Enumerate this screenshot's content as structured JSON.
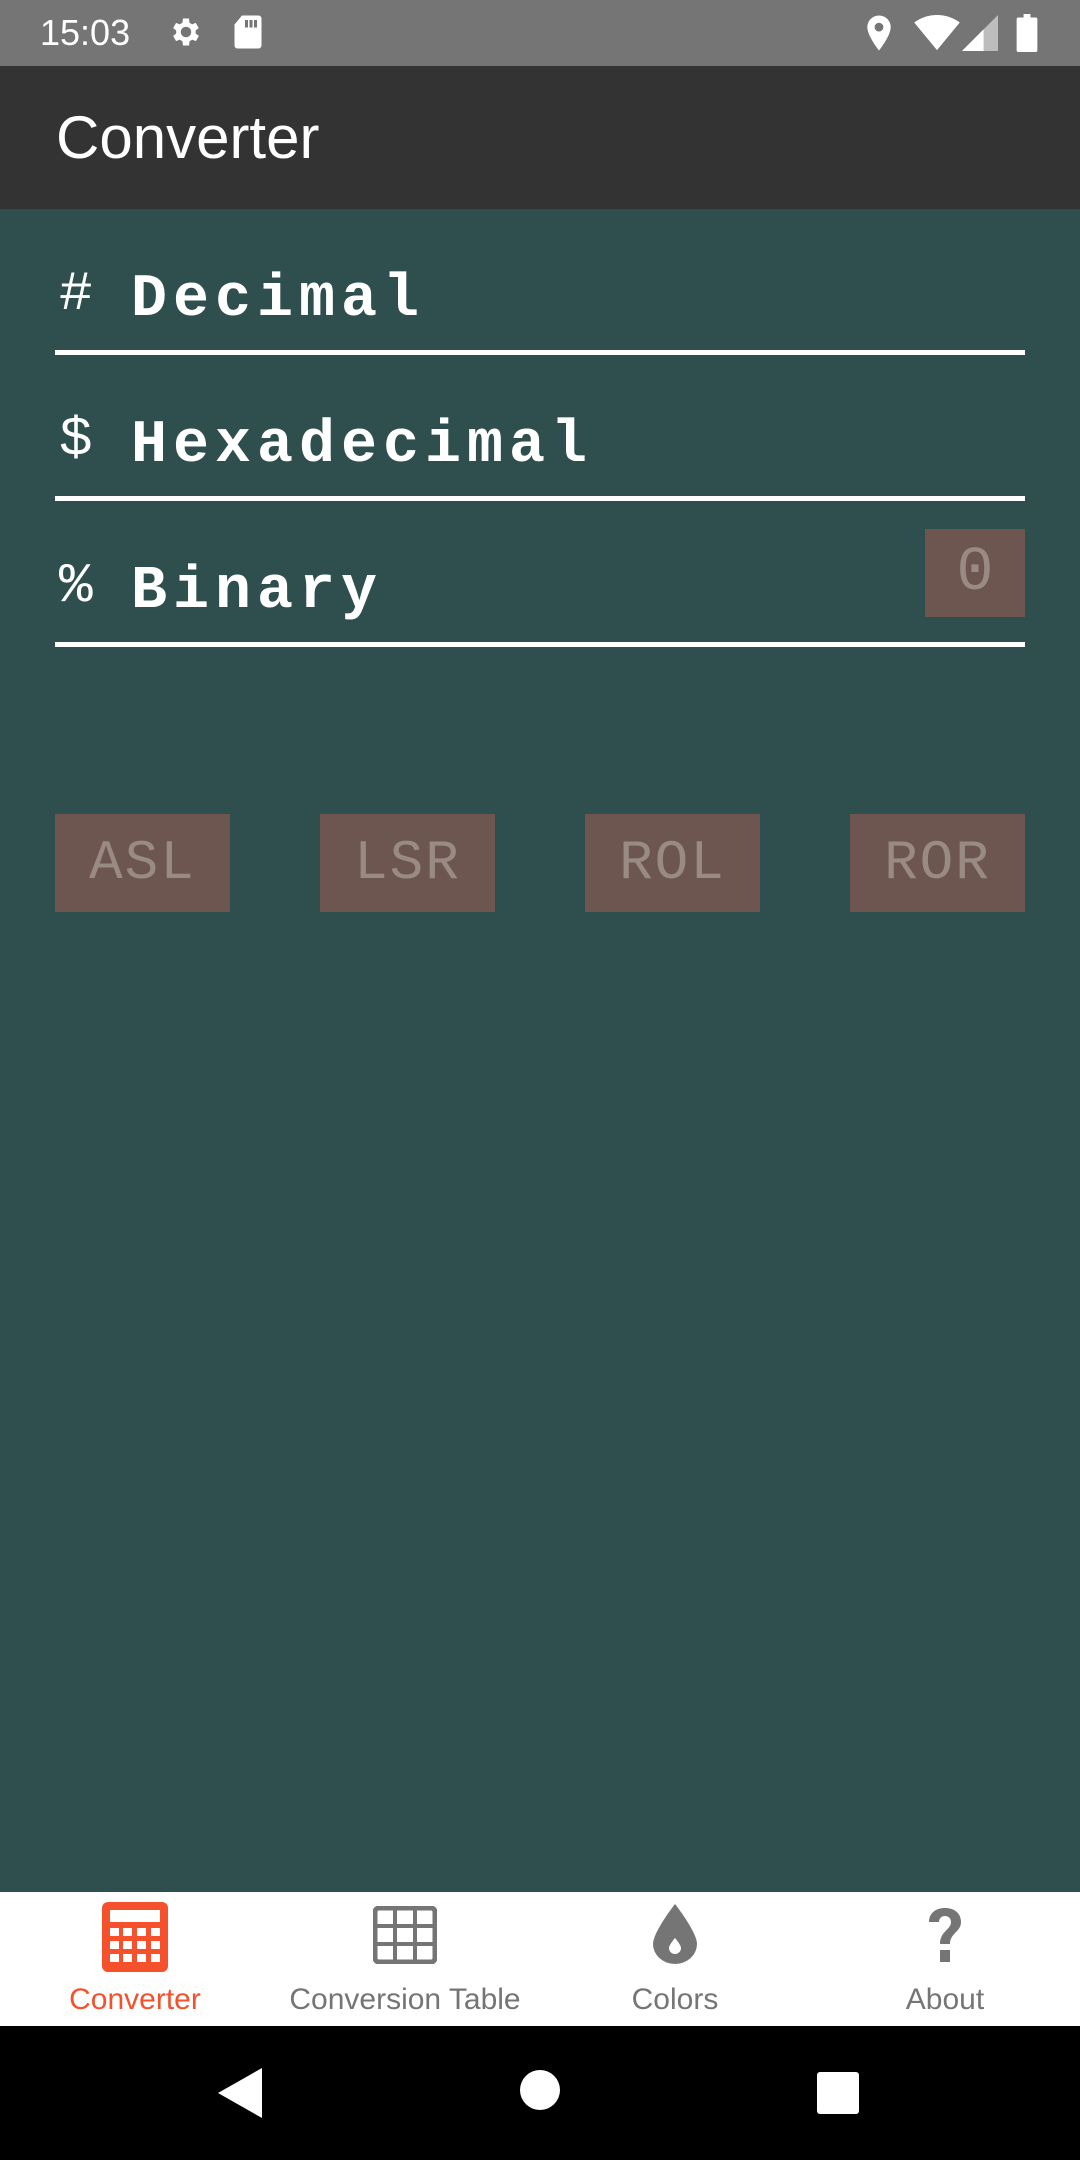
{
  "status_bar": {
    "time": "15:03",
    "icons_left": [
      "settings-icon",
      "sd-card-icon"
    ],
    "icons_right": [
      "location-icon",
      "wifi-icon",
      "signal-icon",
      "battery-icon"
    ]
  },
  "app_bar": {
    "title": "Converter"
  },
  "fields": [
    {
      "prefix": "#",
      "placeholder": "Decimal",
      "value": ""
    },
    {
      "prefix": "$",
      "placeholder": "Hexadecimal",
      "value": ""
    },
    {
      "prefix": "%",
      "placeholder": "Binary",
      "value": "",
      "badge": "0"
    }
  ],
  "shift_buttons": [
    "ASL",
    "LSR",
    "ROL",
    "ROR"
  ],
  "bottom_nav": {
    "items": [
      {
        "label": "Converter",
        "icon": "calculator-icon",
        "active": true
      },
      {
        "label": "Conversion Table",
        "icon": "table-icon",
        "active": false
      },
      {
        "label": "Colors",
        "icon": "drop-icon",
        "active": false
      },
      {
        "label": "About",
        "icon": "help-icon",
        "active": false
      }
    ]
  },
  "colors": {
    "background": "#2f4f4f",
    "app_bar": "#333333",
    "status_bar": "#757575",
    "button_bg": "#6d5650",
    "button_text": "#9a8a84",
    "accent": "#f4512c",
    "nav_inactive": "#757575"
  }
}
